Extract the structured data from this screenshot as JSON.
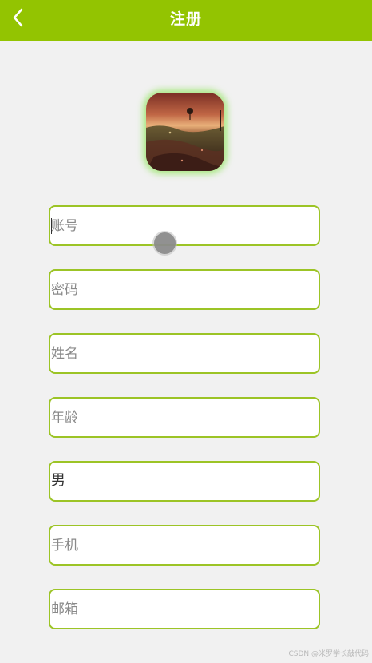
{
  "header": {
    "title": "注册",
    "back_icon": "chevron-left-icon",
    "background_color": "#93c401"
  },
  "avatar": {
    "alt": "sunset landscape avatar"
  },
  "form": {
    "account": {
      "placeholder": "账号",
      "value": ""
    },
    "password": {
      "placeholder": "密码",
      "value": ""
    },
    "name": {
      "placeholder": "姓名",
      "value": ""
    },
    "age": {
      "placeholder": "年龄",
      "value": ""
    },
    "gender": {
      "value": "男"
    },
    "phone": {
      "placeholder": "手机",
      "value": ""
    },
    "email": {
      "placeholder": "邮箱",
      "value": ""
    },
    "border_color": "#9cc426"
  },
  "watermark": "CSDN @米罗学长敲代码"
}
